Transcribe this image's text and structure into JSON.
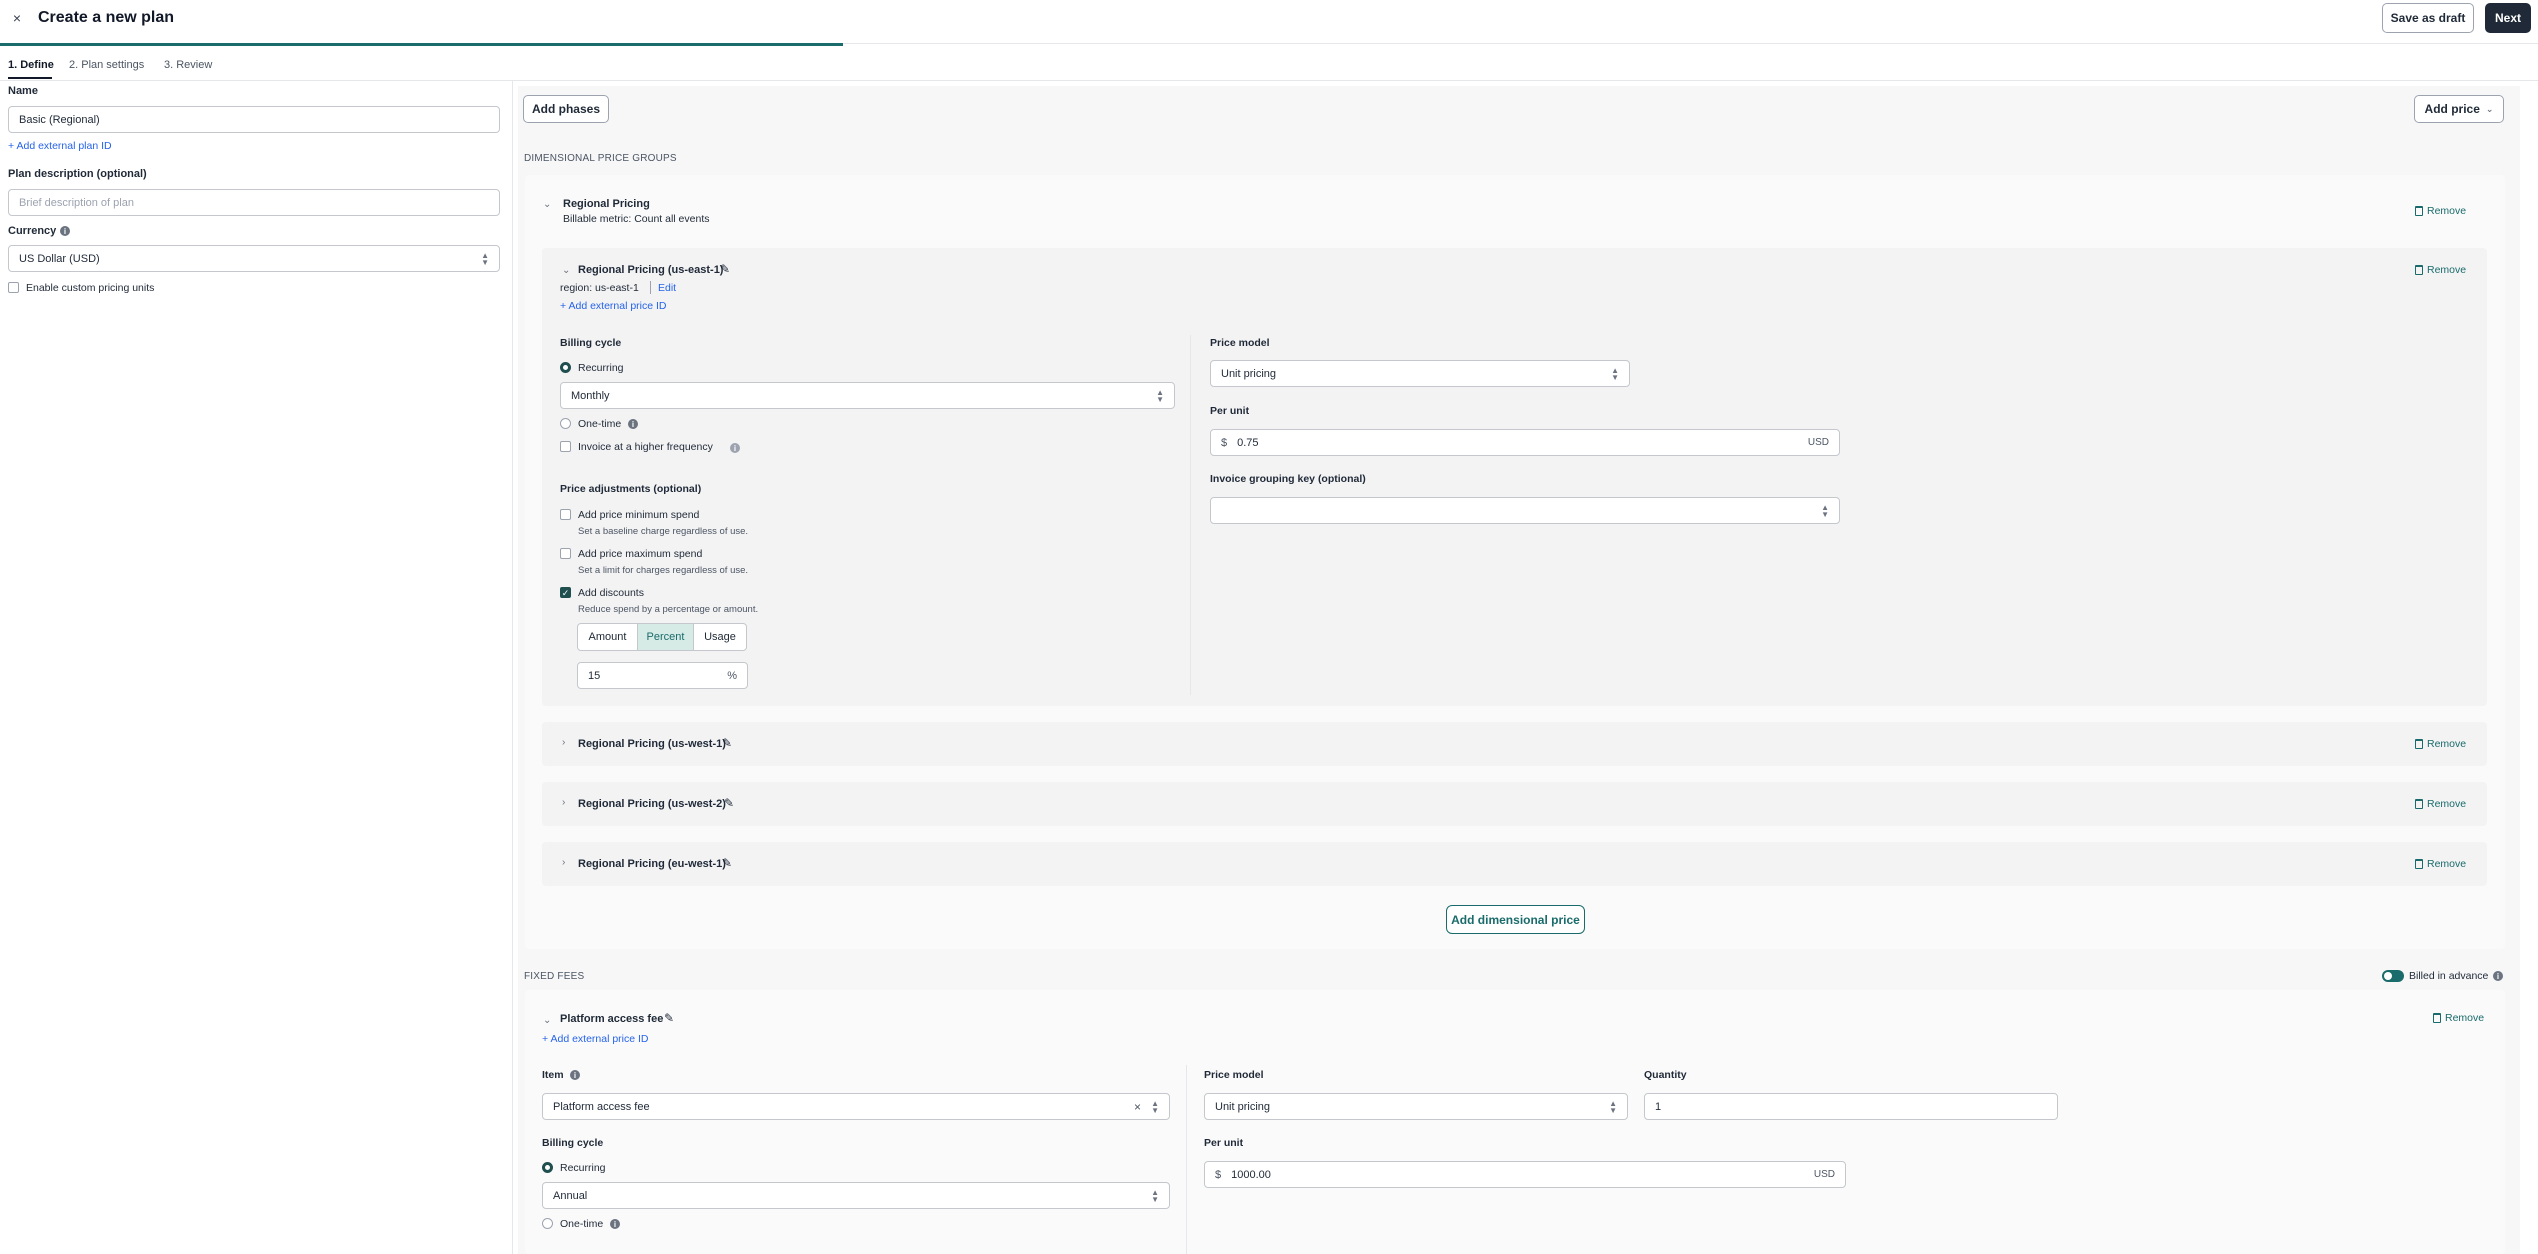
{
  "header": {
    "title": "Create a new plan",
    "save_draft": "Save as draft",
    "next": "Next",
    "close_icon": "close-icon"
  },
  "steps": [
    "1. Define",
    "2. Plan settings",
    "3. Review"
  ],
  "left": {
    "name_label": "Name",
    "name_value": "Basic (Regional)",
    "add_external_plan_id": "+ Add external plan ID",
    "desc_label": "Plan description (optional)",
    "desc_placeholder": "Brief description of plan",
    "currency_label": "Currency",
    "currency_value": "US Dollar (USD)",
    "custom_units": "Enable custom pricing units"
  },
  "main": {
    "add_phases": "Add phases",
    "add_price": "Add price",
    "dim_groups_title": "DIMENSIONAL PRICE GROUPS",
    "group": {
      "title": "Regional Pricing",
      "metric": "Billable metric: Count all events",
      "remove": "Remove"
    },
    "expanded": {
      "title": "Regional Pricing (us-east-1)",
      "region": "region: us-east-1",
      "edit": "Edit",
      "add_external_price_id": "+ Add external price ID",
      "remove": "Remove",
      "billing_cycle_label": "Billing cycle",
      "recurring": "Recurring",
      "cycle_value": "Monthly",
      "one_time": "One-time",
      "invoice_higher": "Invoice at a higher frequency",
      "price_adj_label": "Price adjustments (optional)",
      "min_spend": "Add price minimum spend",
      "min_spend_desc": "Set a baseline charge regardless of use.",
      "max_spend": "Add price maximum spend",
      "max_spend_desc": "Set a limit for charges regardless of use.",
      "discounts": "Add discounts",
      "discounts_desc": "Reduce spend by a percentage or amount.",
      "seg_amount": "Amount",
      "seg_percent": "Percent",
      "seg_usage": "Usage",
      "discount_value": "15",
      "discount_unit": "%",
      "price_model_label": "Price model",
      "price_model_value": "Unit pricing",
      "per_unit_label": "Per unit",
      "currency_symbol": "$",
      "per_unit_value": "0.75",
      "per_unit_currency": "USD",
      "grouping_label": "Invoice grouping key (optional)"
    },
    "collapsed": [
      {
        "title": "Regional Pricing (us-west-1)",
        "remove": "Remove"
      },
      {
        "title": "Regional Pricing (us-west-2)",
        "remove": "Remove"
      },
      {
        "title": "Regional Pricing (eu-west-1)",
        "remove": "Remove"
      }
    ],
    "add_dimensional_price": "Add dimensional price",
    "fixed_fees_title": "FIXED FEES",
    "billed_in_advance": "Billed in advance",
    "fee": {
      "title": "Platform access fee",
      "add_external_price_id": "+ Add external price ID",
      "remove": "Remove",
      "item_label": "Item",
      "item_value": "Platform access fee",
      "price_model_label": "Price model",
      "price_model_value": "Unit pricing",
      "quantity_label": "Quantity",
      "quantity_value": "1",
      "billing_cycle_label": "Billing cycle",
      "recurring": "Recurring",
      "cycle_value": "Annual",
      "one_time": "One-time",
      "per_unit_label": "Per unit",
      "currency_symbol": "$",
      "per_unit_value": "1000.00",
      "per_unit_currency": "USD"
    }
  },
  "colors": {
    "accent": "#1a6b6b",
    "dark": "#1f2937",
    "link": "#2563eb"
  }
}
